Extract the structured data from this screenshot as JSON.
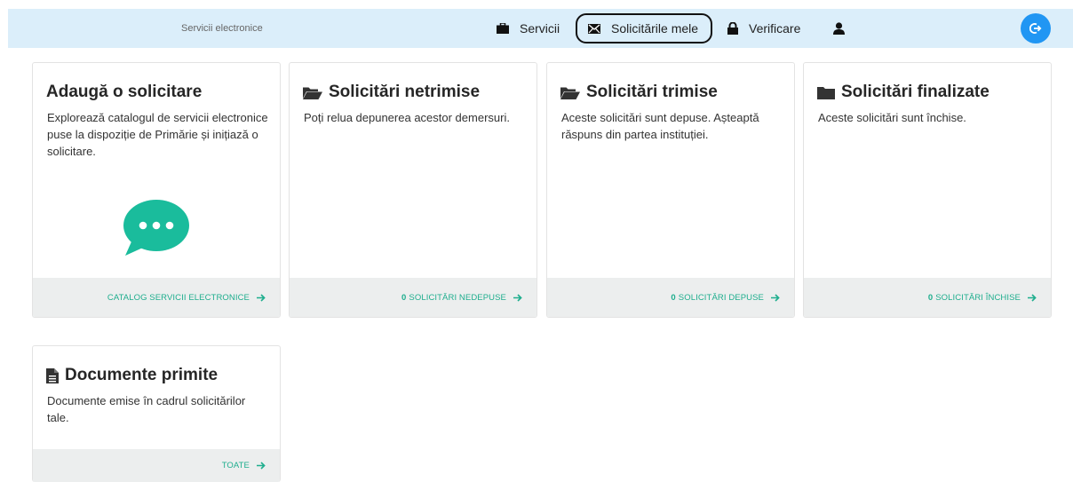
{
  "header": {
    "brand": "Servicii electronice",
    "nav": {
      "servicii": "Servicii",
      "solicitari": "Solicitările mele",
      "verificare": "Verificare"
    }
  },
  "cards": {
    "adauga": {
      "title": "Adaugă o solicitare",
      "desc": "Explorează catalogul de servicii electronice puse la dispoziție de Primărie și inițiază o solicitare.",
      "link": "CATALOG SERVICII ELECTRONICE"
    },
    "netrimise": {
      "title": "Solicitări netrimise",
      "desc": "Poți relua depunerea acestor demersuri.",
      "count": "0",
      "link": "SOLICITĂRI NEDEPUSE"
    },
    "trimise": {
      "title": "Solicitări trimise",
      "desc": "Aceste solicitări sunt depuse. Așteaptă răspuns din partea instituției.",
      "count": "0",
      "link": "SOLICITĂRI DEPUSE"
    },
    "finalizate": {
      "title": "Solicitări finalizate",
      "desc": "Aceste solicitări sunt închise.",
      "count": "0",
      "link": "SOLICITĂRI ÎNCHISE"
    },
    "documente": {
      "title": "Documente primite",
      "desc": "Documente emise în cadrul solicitărilor tale.",
      "link": "TOATE"
    }
  },
  "icons": {
    "servicii": "briefcase-icon",
    "solicitari": "envelope-icon",
    "verificare": "lock-icon",
    "profil": "user-icon",
    "logout": "logout-icon",
    "folder_open": "folder-open-icon",
    "folder": "folder-icon",
    "document": "document-icon",
    "chat": "chat-bubble-icon",
    "arrow": "arrow-right-icon"
  },
  "colors": {
    "topbar": "#dbeefa",
    "accent": "#1fae8e",
    "chat": "#1abc9c",
    "logout": "#2196f3",
    "footer": "#eceeee"
  }
}
